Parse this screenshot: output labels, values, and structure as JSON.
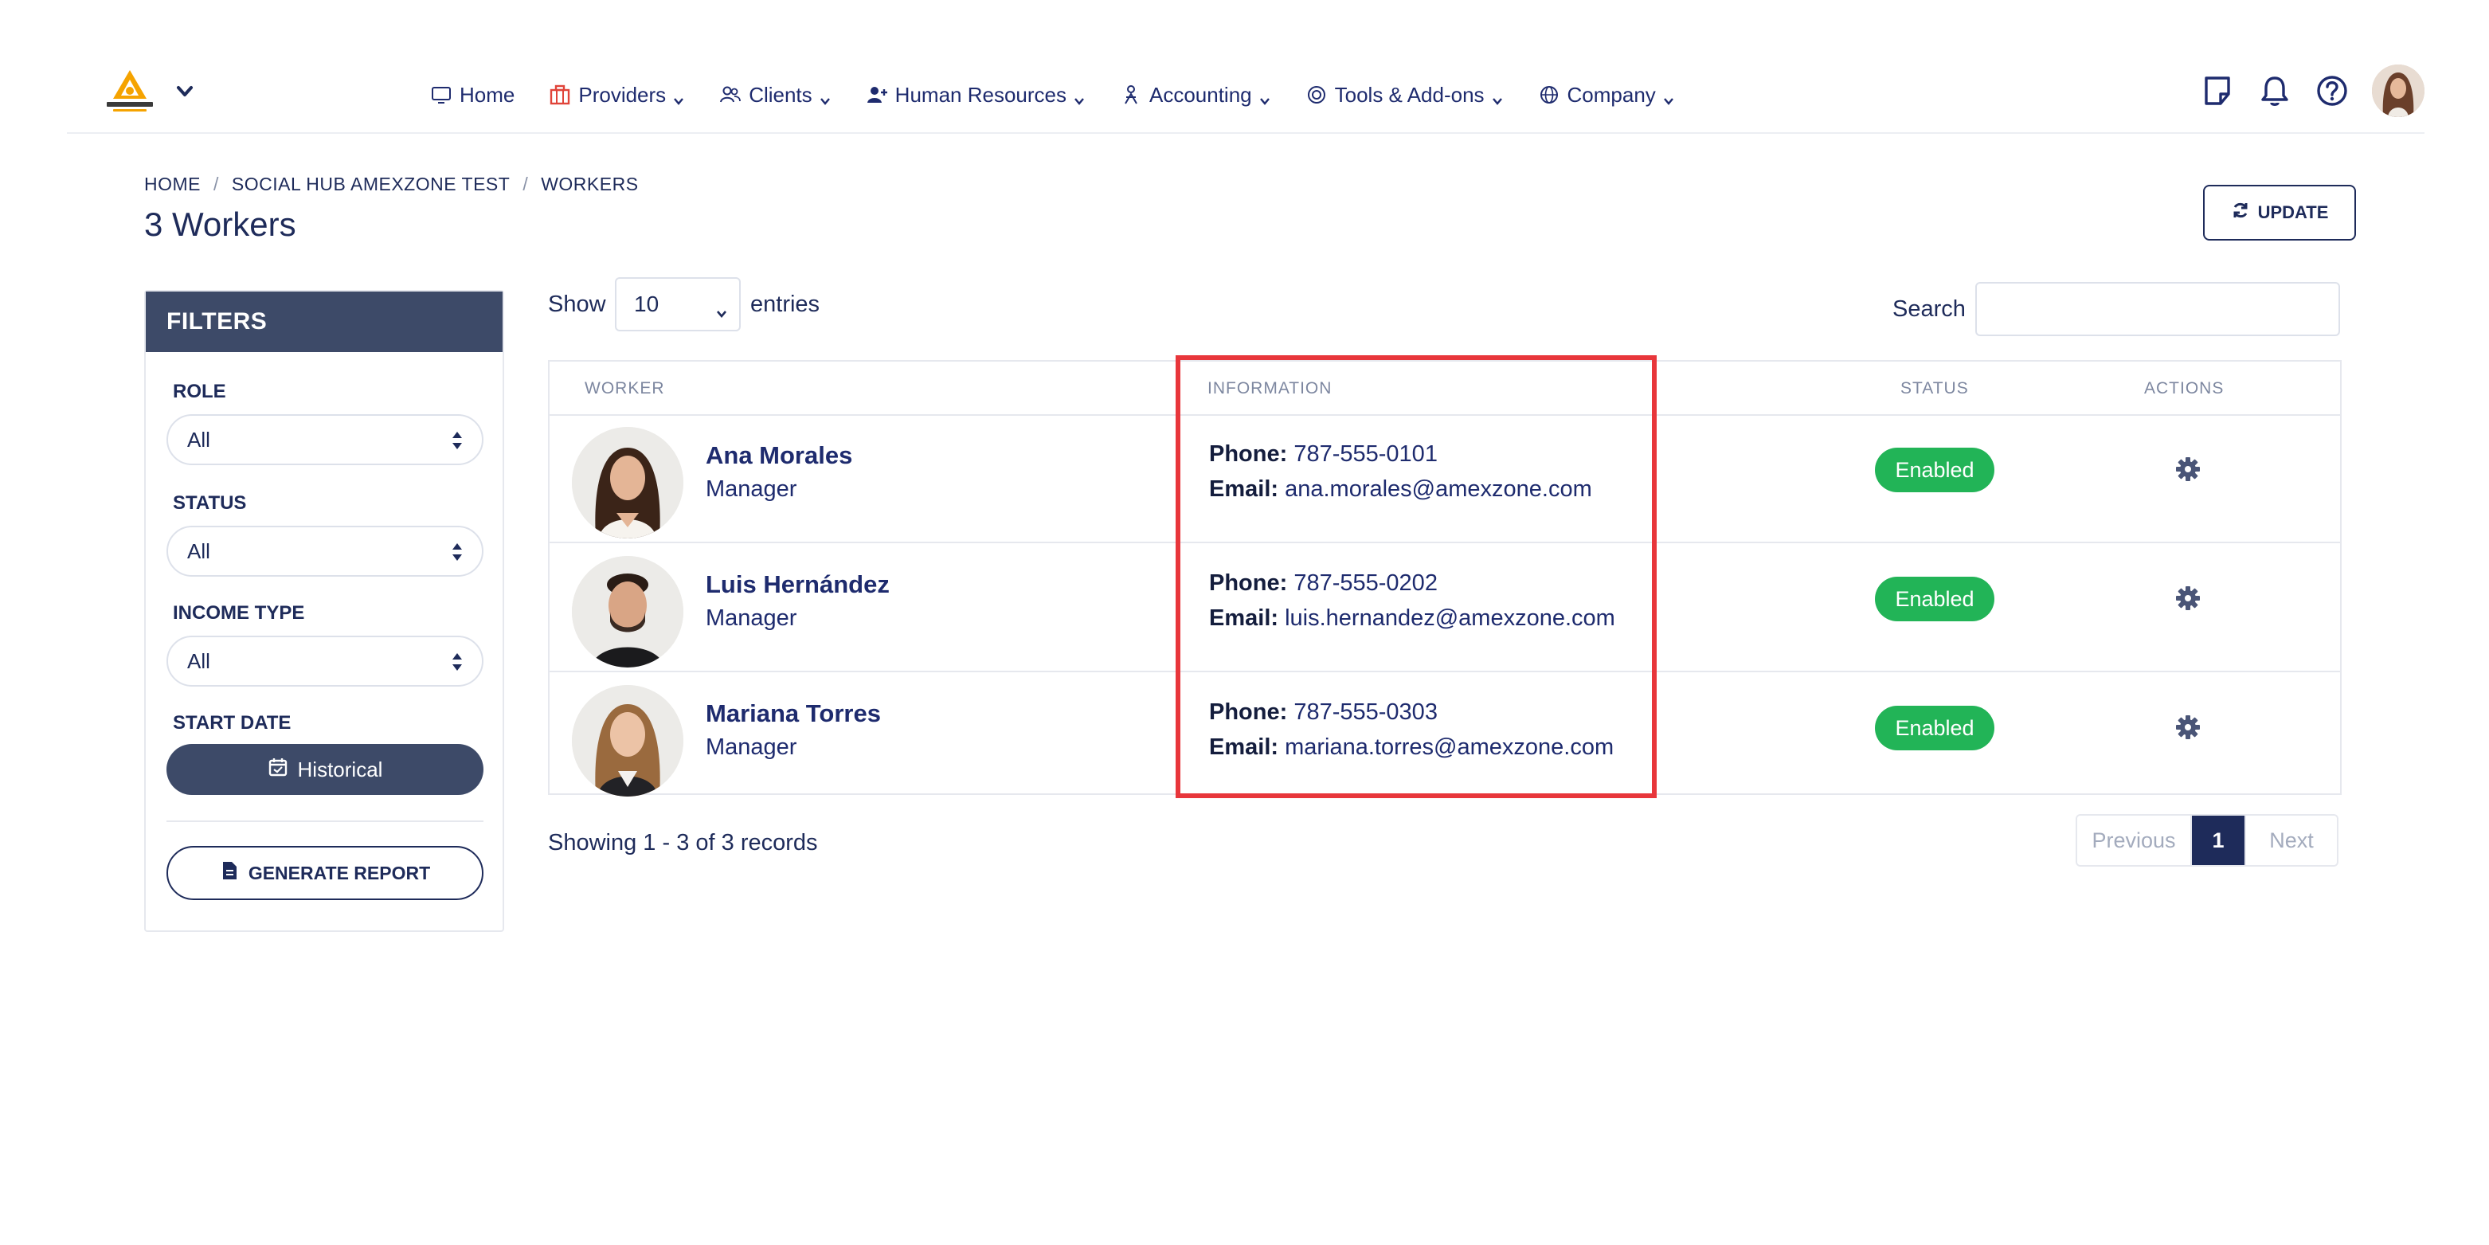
{
  "nav": {
    "items": [
      {
        "label": "Home",
        "icon": "monitor-icon",
        "caret": false
      },
      {
        "label": "Providers",
        "icon": "building-icon",
        "caret": true
      },
      {
        "label": "Clients",
        "icon": "users-icon",
        "caret": true
      },
      {
        "label": "Human Resources",
        "icon": "user-plus-icon",
        "caret": true
      },
      {
        "label": "Accounting",
        "icon": "accounting-icon",
        "caret": true
      },
      {
        "label": "Tools & Add-ons",
        "icon": "target-icon",
        "caret": true
      },
      {
        "label": "Company",
        "icon": "globe-icon",
        "caret": true
      }
    ],
    "right_icons": [
      "notes-icon",
      "bell-icon",
      "help-icon"
    ],
    "accent": "#1e2b6e",
    "providers_icon_color": "#e0443a"
  },
  "header": {
    "breadcrumb": [
      "HOME",
      "SOCIAL HUB AMEXZONE TEST",
      "WORKERS"
    ],
    "title": "3 Workers",
    "update_label": "UPDATE"
  },
  "filters": {
    "title": "FILTERS",
    "role": {
      "label": "ROLE",
      "value": "All"
    },
    "status": {
      "label": "STATUS",
      "value": "All"
    },
    "income_type": {
      "label": "INCOME TYPE",
      "value": "All"
    },
    "start_date": {
      "label": "START DATE",
      "button": "Historical"
    },
    "report_label": "GENERATE REPORT",
    "header_color": "#3d4a68"
  },
  "table": {
    "show_label": "Show",
    "entries_value": "10",
    "entries_label": "entries",
    "search_label": "Search",
    "search_value": "",
    "columns": [
      "WORKER",
      "INFORMATION",
      "STATUS",
      "ACTIONS"
    ],
    "phone_label": "Phone:",
    "email_label": "Email:",
    "rows": [
      {
        "name": "Ana Morales",
        "role": "Manager",
        "phone": "787-555-0101",
        "email": "ana.morales@amexzone.com",
        "status": "Enabled"
      },
      {
        "name": "Luis Hernández",
        "role": "Manager",
        "phone": "787-555-0202",
        "email": "luis.hernandez@amexzone.com",
        "status": "Enabled"
      },
      {
        "name": "Mariana Torres",
        "role": "Manager",
        "phone": "787-555-0303",
        "email": "mariana.torres@amexzone.com",
        "status": "Enabled"
      }
    ],
    "status_color": "#22b457",
    "highlight_color": "#e8363b"
  },
  "footer": {
    "showing": "Showing 1 - 3 of 3 records",
    "previous": "Previous",
    "current_page": "1",
    "next": "Next"
  }
}
